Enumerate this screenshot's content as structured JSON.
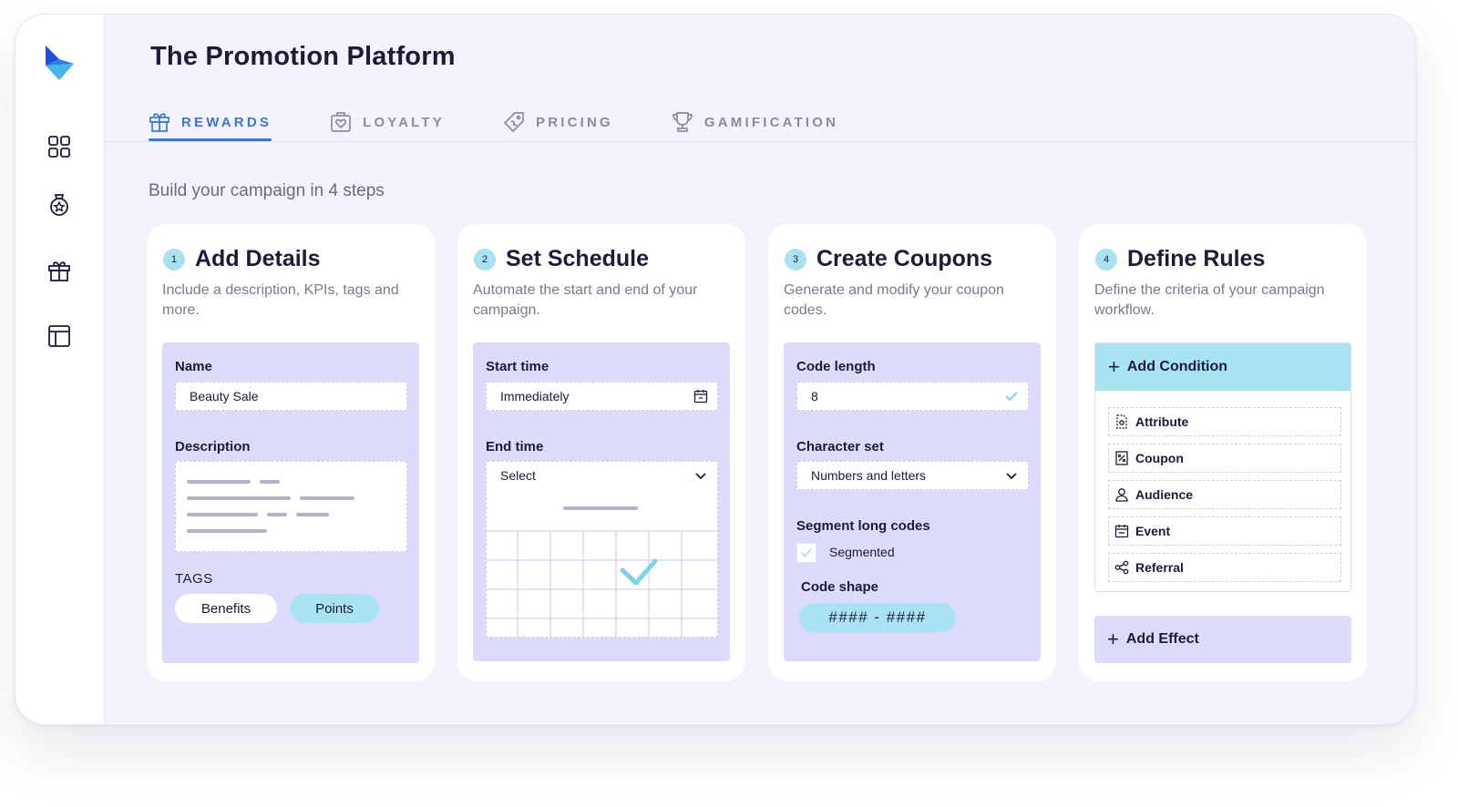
{
  "app": {
    "title": "The Promotion Platform",
    "accent_color": "#3a78d0",
    "highlight_color": "#a9e3f2",
    "panel_color": "#dcdbfb"
  },
  "sidebar": {
    "logo_icon": "brand-logo-icon",
    "items": [
      {
        "icon": "dashboard-grid-icon"
      },
      {
        "icon": "medal-icon"
      },
      {
        "icon": "gift-icon"
      },
      {
        "icon": "layout-table-icon"
      }
    ]
  },
  "tabs": [
    {
      "label": "REWARDS",
      "icon": "gift-icon",
      "active": true
    },
    {
      "label": "LOYALTY",
      "icon": "heart-box-icon",
      "active": false
    },
    {
      "label": "PRICING",
      "icon": "price-tag-icon",
      "active": false
    },
    {
      "label": "GAMIFICATION",
      "icon": "trophy-icon",
      "active": false
    }
  ],
  "subtitle": "Build your campaign in 4 steps",
  "steps": [
    {
      "number": "1",
      "title": "Add Details",
      "description": "Include a description, KPIs, tags and more.",
      "name_label": "Name",
      "name_value": "Beauty Sale",
      "description_label": "Description",
      "tags_label": "TAGS",
      "tags": [
        "Benefits",
        "Points"
      ]
    },
    {
      "number": "2",
      "title": "Set Schedule",
      "description": "Automate the start and end of your campaign.",
      "start_label": "Start time",
      "start_value": "Immediately",
      "end_label": "End time",
      "end_value": "Select"
    },
    {
      "number": "3",
      "title": "Create Coupons",
      "description": "Generate and modify your coupon codes.",
      "code_length_label": "Code length",
      "code_length_value": "8",
      "charset_label": "Character set",
      "charset_value": "Numbers and letters",
      "segment_label": "Segment long codes",
      "segment_option": "Segmented",
      "segment_checked": true,
      "code_shape_label": "Code shape",
      "code_shape_value": "#### - ####"
    },
    {
      "number": "4",
      "title": "Define Rules",
      "description": "Define the criteria of your campaign workflow.",
      "add_condition": "Add Condition",
      "conditions": [
        {
          "label": "Attribute",
          "icon": "attribute-icon"
        },
        {
          "label": "Coupon",
          "icon": "coupon-icon"
        },
        {
          "label": "Audience",
          "icon": "person-icon"
        },
        {
          "label": "Event",
          "icon": "calendar-icon"
        },
        {
          "label": "Referral",
          "icon": "share-nodes-icon"
        }
      ],
      "add_effect": "Add Effect"
    }
  ]
}
